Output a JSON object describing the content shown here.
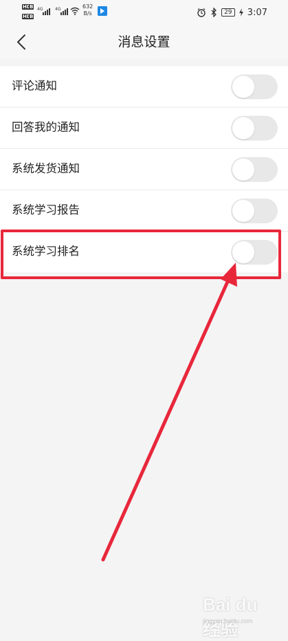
{
  "status_bar": {
    "left": {
      "hd1": "HD",
      "hd2": "HD",
      "sig1": "4G",
      "sig2": "4G",
      "speed_value": "632",
      "speed_unit": "B/s"
    },
    "right": {
      "battery": "29",
      "time": "3:07"
    }
  },
  "header": {
    "title": "消息设置"
  },
  "settings": [
    {
      "label": "评论通知",
      "enabled": false
    },
    {
      "label": "回答我的通知",
      "enabled": false
    },
    {
      "label": "系统发货通知",
      "enabled": false
    },
    {
      "label": "系统学习报告",
      "enabled": false
    },
    {
      "label": "系统学习排名",
      "enabled": false
    }
  ],
  "colors": {
    "highlight": "#e8273b",
    "toggle_off": "#e8e8e8",
    "background": "#f4f4f4"
  },
  "watermark": {
    "logo": "Bai du 经验",
    "sub": "jingyan.baidu.com"
  }
}
